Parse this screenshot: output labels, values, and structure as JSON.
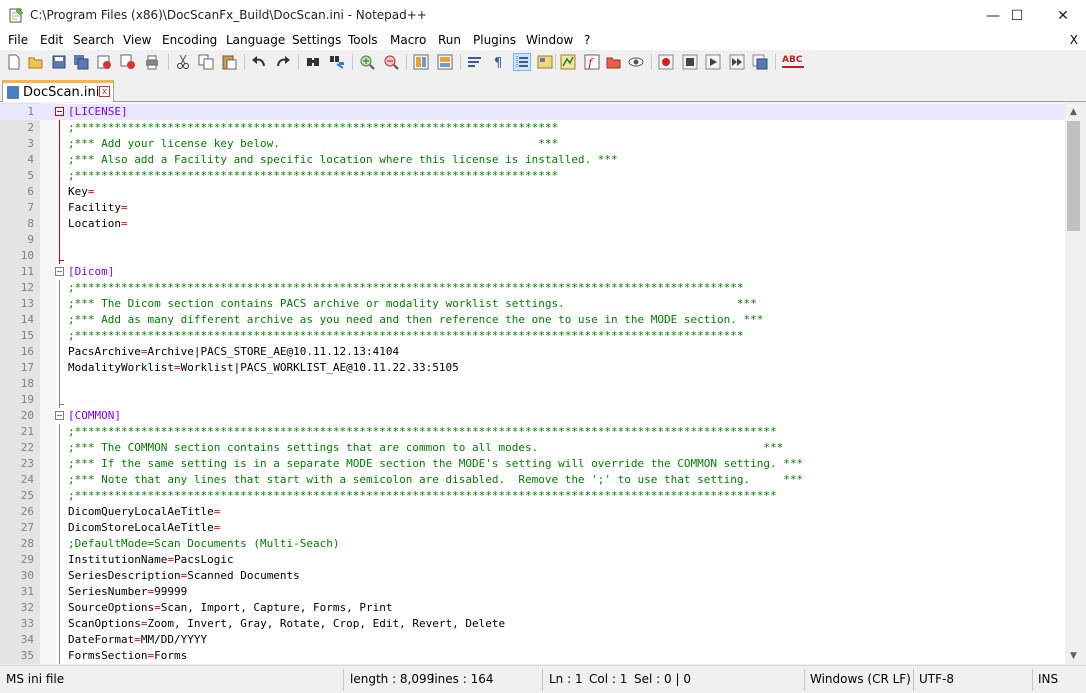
{
  "window": {
    "title": "C:\\Program Files (x86)\\DocScanFx_Build\\DocScan.ini - Notepad++",
    "minimize": "—",
    "maximize": "☐",
    "close": "✕"
  },
  "menu": [
    "File",
    "Edit",
    "Search",
    "View",
    "Encoding",
    "Language",
    "Settings",
    "Tools",
    "Macro",
    "Run",
    "Plugins",
    "Window",
    "?"
  ],
  "menu_close": "X",
  "toolbar": {
    "icons": [
      "new-file-icon",
      "open-file-icon",
      "save-icon",
      "save-all-icon",
      "close-icon",
      "close-all-icon",
      "print-icon",
      "cut-icon",
      "copy-icon",
      "paste-icon",
      "undo-icon",
      "redo-icon",
      "find-icon",
      "replace-icon",
      "zoom-in-icon",
      "zoom-out-icon",
      "sync-vertical-icon",
      "sync-horizontal-icon",
      "word-wrap-icon",
      "show-all-characters-icon",
      "indent-guide-icon",
      "user-defined-language-icon",
      "document-map-icon",
      "function-list-icon",
      "folder-as-workspace-icon",
      "monitoring-icon",
      "record-macro-icon",
      "stop-recording-icon",
      "playback-macro-icon",
      "run-macro-multiple-icon",
      "save-macro-icon",
      "spell-check-icon"
    ],
    "spellcheck_label": "ABC"
  },
  "tab": {
    "label": "DocScan.ini",
    "close": "x"
  },
  "editor": {
    "lines": [
      {
        "n": "1",
        "type": "section",
        "name": "LICENSE"
      },
      {
        "n": "2",
        "type": "comment",
        "text": ";*************************************************************************"
      },
      {
        "n": "3",
        "type": "comment",
        "text": ";*** Add your license key below.                                       ***"
      },
      {
        "n": "4",
        "type": "comment",
        "text": ";*** Also add a Facility and specific location where this license is installed. ***"
      },
      {
        "n": "5",
        "type": "comment",
        "text": ";*************************************************************************"
      },
      {
        "n": "6",
        "type": "kv",
        "key": "Key",
        "value": ""
      },
      {
        "n": "7",
        "type": "kv",
        "key": "Facility",
        "value": ""
      },
      {
        "n": "8",
        "type": "kv",
        "key": "Location",
        "value": ""
      },
      {
        "n": "9",
        "type": "blank"
      },
      {
        "n": "10",
        "type": "blank"
      },
      {
        "n": "11",
        "type": "section",
        "name": "Dicom"
      },
      {
        "n": "12",
        "type": "comment",
        "text": ";*****************************************************************************************************"
      },
      {
        "n": "13",
        "type": "comment",
        "text": ";*** The Dicom section contains PACS archive or modality worklist settings.                          ***"
      },
      {
        "n": "14",
        "type": "comment",
        "text": ";*** Add as many different archive as you need and then reference the one to use in the MODE section. ***"
      },
      {
        "n": "15",
        "type": "comment",
        "text": ";*****************************************************************************************************"
      },
      {
        "n": "16",
        "type": "kv",
        "key": "PacsArchive",
        "value": "Archive|PACS_STORE_AE@10.11.12.13:4104"
      },
      {
        "n": "17",
        "type": "kv",
        "key": "ModalityWorklist",
        "value": "Worklist|PACS_WORKLIST_AE@10.11.22.33:5105"
      },
      {
        "n": "18",
        "type": "blank"
      },
      {
        "n": "19",
        "type": "blank"
      },
      {
        "n": "20",
        "type": "section",
        "name": "COMMON"
      },
      {
        "n": "21",
        "type": "comment",
        "text": ";**********************************************************************************************************"
      },
      {
        "n": "22",
        "type": "comment",
        "text": ";*** The COMMON section contains settings that are common to all modes.                                  ***"
      },
      {
        "n": "23",
        "type": "comment",
        "text": ";*** If the same setting is in a separate MODE section the MODE's setting will override the COMMON setting. ***"
      },
      {
        "n": "24",
        "type": "comment",
        "text": ";*** Note that any lines that start with a semicolon are disabled.  Remove the ';' to use that setting.     ***"
      },
      {
        "n": "25",
        "type": "comment",
        "text": ";**********************************************************************************************************"
      },
      {
        "n": "26",
        "type": "kv",
        "key": "DicomQueryLocalAeTitle",
        "value": ""
      },
      {
        "n": "27",
        "type": "kv",
        "key": "DicomStoreLocalAeTitle",
        "value": ""
      },
      {
        "n": "28",
        "type": "comment",
        "text": ";DefaultMode=Scan Documents (Multi-Seach)"
      },
      {
        "n": "29",
        "type": "kv",
        "key": "InstitutionName",
        "value": "PacsLogic"
      },
      {
        "n": "30",
        "type": "kv",
        "key": "SeriesDescription",
        "value": "Scanned Documents"
      },
      {
        "n": "31",
        "type": "kv",
        "key": "SeriesNumber",
        "value": "99999"
      },
      {
        "n": "32",
        "type": "kv",
        "key": "SourceOptions",
        "value": "Scan, Import, Capture, Forms, Print"
      },
      {
        "n": "33",
        "type": "kv",
        "key": "ScanOptions",
        "value": "Zoom, Invert, Gray, Rotate, Crop, Edit, Revert, Delete"
      },
      {
        "n": "34",
        "type": "kv",
        "key": "DateFormat",
        "value": "MM/DD/YYYY"
      },
      {
        "n": "35",
        "type": "kv",
        "key": "FormsSection",
        "value": "Forms"
      }
    ]
  },
  "status": {
    "filetype": "MS ini file",
    "length": "length : 8,099",
    "lines": "lines : 164",
    "ln": "Ln : 1",
    "col": "Col : 1",
    "sel": "Sel : 0 | 0",
    "eol": "Windows (CR LF)",
    "encoding": "UTF-8",
    "mode": "INS"
  },
  "colors": {
    "section": "#8000ff",
    "comment": "#008000",
    "equals": "#ff0000",
    "current_line": "#e8e8ff",
    "tab_accent": "#fab446"
  }
}
